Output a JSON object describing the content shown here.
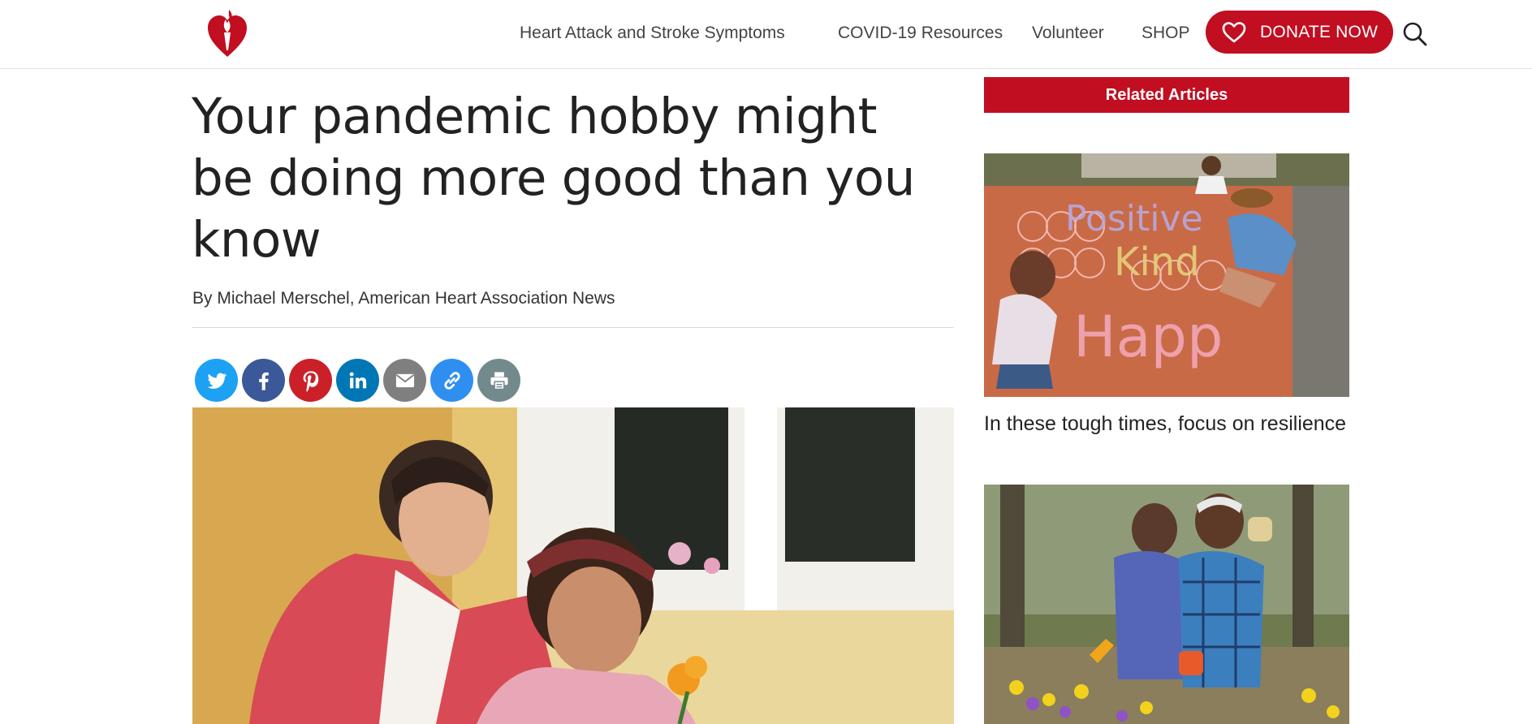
{
  "header": {
    "nav": [
      {
        "label": "Heart Attack and Stroke Symptoms"
      },
      {
        "label": "COVID-19 Resources"
      },
      {
        "label": "Volunteer"
      },
      {
        "label": "SHOP"
      }
    ],
    "donate_label": "DONATE NOW",
    "brand_color": "#c10e21"
  },
  "article": {
    "headline": "Your pandemic hobby might be doing more good than you know",
    "byline": "By Michael Merschel, American Heart Association News",
    "share": [
      {
        "icon": "twitter-icon",
        "color": "#1da1f2"
      },
      {
        "icon": "facebook-icon",
        "color": "#3b5998"
      },
      {
        "icon": "pinterest-icon",
        "color": "#cb2027"
      },
      {
        "icon": "linkedin-icon",
        "color": "#0077b5"
      },
      {
        "icon": "email-icon",
        "color": "#7f7f7f"
      },
      {
        "icon": "link-icon",
        "color": "#2f8ff0"
      },
      {
        "icon": "print-icon",
        "color": "#738a8d"
      }
    ]
  },
  "sidebar": {
    "heading": "Related Articles",
    "cards": [
      {
        "title": "In these tough times, focus on resilience"
      }
    ]
  }
}
